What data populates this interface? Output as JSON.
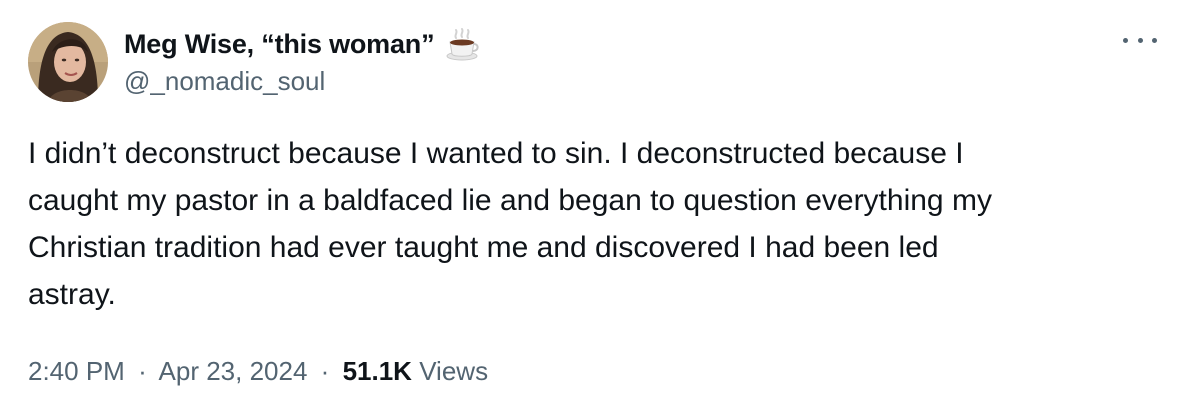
{
  "author": {
    "display_name": "Meg Wise, “this woman”",
    "handle": "@_nomadic_soul",
    "name_emoji": "hot-beverage-icon"
  },
  "tweet": {
    "text_lines": [
      "I didn’t deconstruct because I wanted to sin. I deconstructed because I",
      "caught my pastor in a baldfaced lie and began to question everything my",
      "Christian tradition had ever taught me and discovered I had been led",
      "astray."
    ]
  },
  "meta": {
    "time": "2:40 PM",
    "separator": "·",
    "date": "Apr 23, 2024",
    "views_count": "51.1K",
    "views_label": "Views"
  },
  "colors": {
    "primary_text": "#0f1419",
    "secondary_text": "#536471",
    "background": "#ffffff"
  }
}
